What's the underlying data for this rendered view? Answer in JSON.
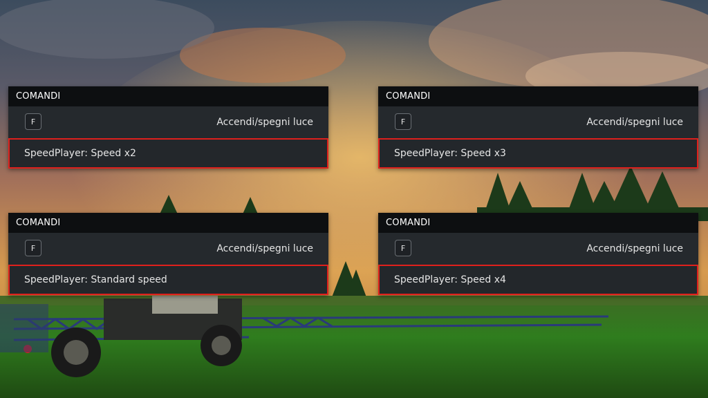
{
  "panels": [
    {
      "header": "COMANDI",
      "key": "F",
      "action": "Accendi/spegni luce",
      "speed": "SpeedPlayer: Speed x2"
    },
    {
      "header": "COMANDI",
      "key": "F",
      "action": "Accendi/spegni luce",
      "speed": "SpeedPlayer: Speed x3"
    },
    {
      "header": "COMANDI",
      "key": "F",
      "action": "Accendi/spegni luce",
      "speed": "SpeedPlayer: Standard speed"
    },
    {
      "header": "COMANDI",
      "key": "F",
      "action": "Accendi/spegni luce",
      "speed": "SpeedPlayer: Speed x4"
    }
  ],
  "colors": {
    "panel_bg": "#23272b",
    "header_bg": "#0d0f11",
    "highlight_border": "#e0201c",
    "text": "#e6e6e6"
  }
}
